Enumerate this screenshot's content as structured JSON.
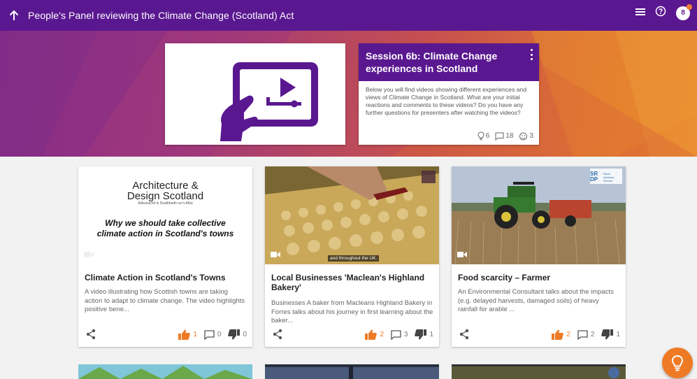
{
  "header": {
    "title": "People's Panel reviewing the Climate Change (Scotland) Act",
    "avatar_initial": "8",
    "icons": [
      "arrow-up-icon",
      "menu-icon",
      "help-icon"
    ]
  },
  "session": {
    "title": "Session 6b: Climate Change experiences in Scotland",
    "description": "Below you will find videos showing different experiences and views of Climate Change in Scotland. What are your initial reactions and comments to these videos? Do you have any further questions for presenters after watching the videos?",
    "ideas": "6",
    "comments": "18",
    "participants": "3"
  },
  "cards": [
    {
      "thumb_brand_line1": "Architecture &",
      "thumb_brand_line2": "Design Scotland",
      "thumb_brand_sub": "Ailtearachd is Dealbhadh na h-Alba",
      "thumb_caption_line1": "Why we should take collective",
      "thumb_caption_line2": "climate action in Scotland's towns",
      "title": "Climate Action in Scotland's Towns",
      "description": "A video illustrating how Scottish towns are taking action to adapt to climate change. The video highlights positive bene...",
      "likes": "1",
      "comments": "0",
      "dislikes": "0"
    },
    {
      "thumb_subtitle": "and throughout the UK.",
      "title": "Local Businesses 'Maclean's Highland Bakery'",
      "description": "Businesses A baker from Macleans Highland Bakery in Forres talks about his journey in first learning about the baker...",
      "likes": "2",
      "comments": "3",
      "dislikes": "1"
    },
    {
      "thumb_logo": "SR DP",
      "thumb_logo_text": "Rural Advisory Service",
      "title": "Food scarcity – Farmer",
      "description": "An Environmental Consultant talks about the impacts (e.g. delayed harvests, damaged soils) of heavy rainfall for arable ...",
      "likes": "2",
      "comments": "2",
      "dislikes": "1"
    }
  ],
  "colors": {
    "brand": "#5a1890",
    "accent": "#ef7a25",
    "like": "#ef7a25"
  }
}
